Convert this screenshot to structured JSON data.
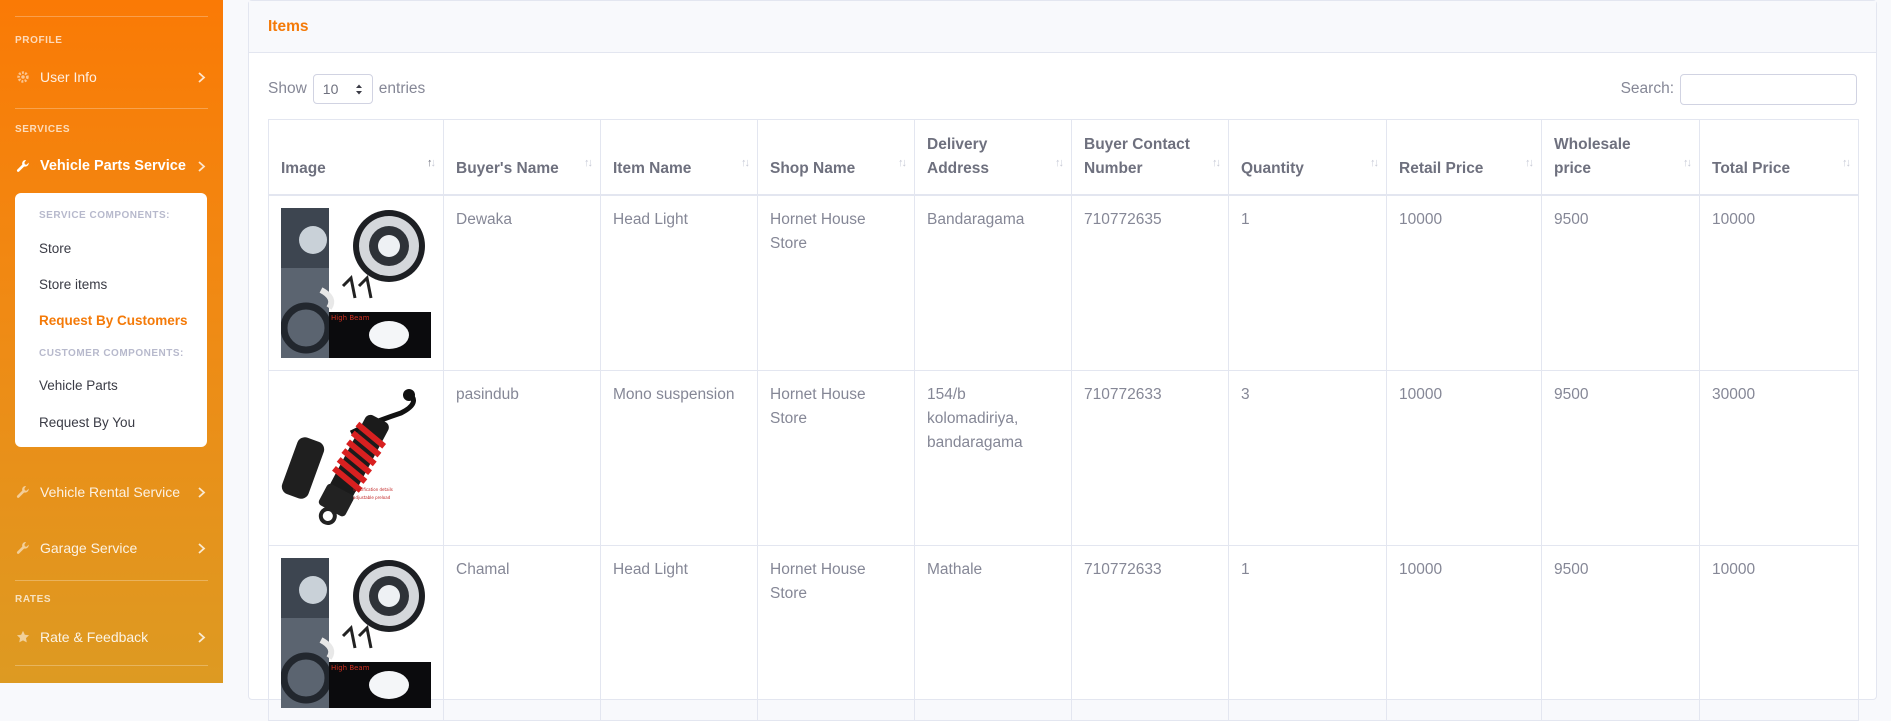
{
  "sidebar": {
    "profile_heading": "PROFILE",
    "user_info": "User Info",
    "services_heading": "SERVICES",
    "vehicle_parts_service": "Vehicle Parts Service",
    "submenu": {
      "service_components_heading": "SERVICE COMPONENTS:",
      "store": "Store",
      "store_items": "Store items",
      "request_by_customers": "Request By Customers",
      "customer_components_heading": "CUSTOMER COMPONENTS:",
      "vehicle_parts": "Vehicle Parts",
      "request_by_you": "Request By You"
    },
    "vehicle_rental_service": "Vehicle Rental Service",
    "garage_service": "Garage Service",
    "rates_heading": "RATES",
    "rate_feedback": "Rate & Feedback",
    "colors": {
      "gradient_top": "#fa7a05",
      "gradient_bottom": "#dd9a22",
      "active_text": "#f47a08"
    }
  },
  "card": {
    "title": "Items",
    "show_label": "Show",
    "entries_value": "10",
    "entries_label": "entries",
    "search_label": "Search:",
    "search_value": ""
  },
  "table": {
    "headers": [
      "Image",
      "Buyer's Name",
      "Item Name",
      "Shop Name",
      "Delivery Address",
      "Buyer Contact Number",
      "Quantity",
      "Retail Price",
      "Wholesale price",
      "Total Price"
    ],
    "rows": [
      {
        "image": "headlight-icon",
        "buyer": "Dewaka",
        "item": "Head Light",
        "shop": "Hornet House Store",
        "address": "Bandaragama",
        "contact": "710772635",
        "qty": "1",
        "retail": "10000",
        "wholesale": "9500",
        "total": "10000"
      },
      {
        "image": "suspension-icon",
        "buyer": "pasindub",
        "item": "Mono suspension",
        "shop": "Hornet House Store",
        "address": "154/b kolomadiriya, bandaragama",
        "contact": "710772633",
        "qty": "3",
        "retail": "10000",
        "wholesale": "9500",
        "total": "30000"
      },
      {
        "image": "headlight-icon",
        "buyer": "Chamal",
        "item": "Head Light",
        "shop": "Hornet House Store",
        "address": "Mathale",
        "contact": "710772633",
        "qty": "1",
        "retail": "10000",
        "wholesale": "9500",
        "total": "10000"
      }
    ]
  }
}
